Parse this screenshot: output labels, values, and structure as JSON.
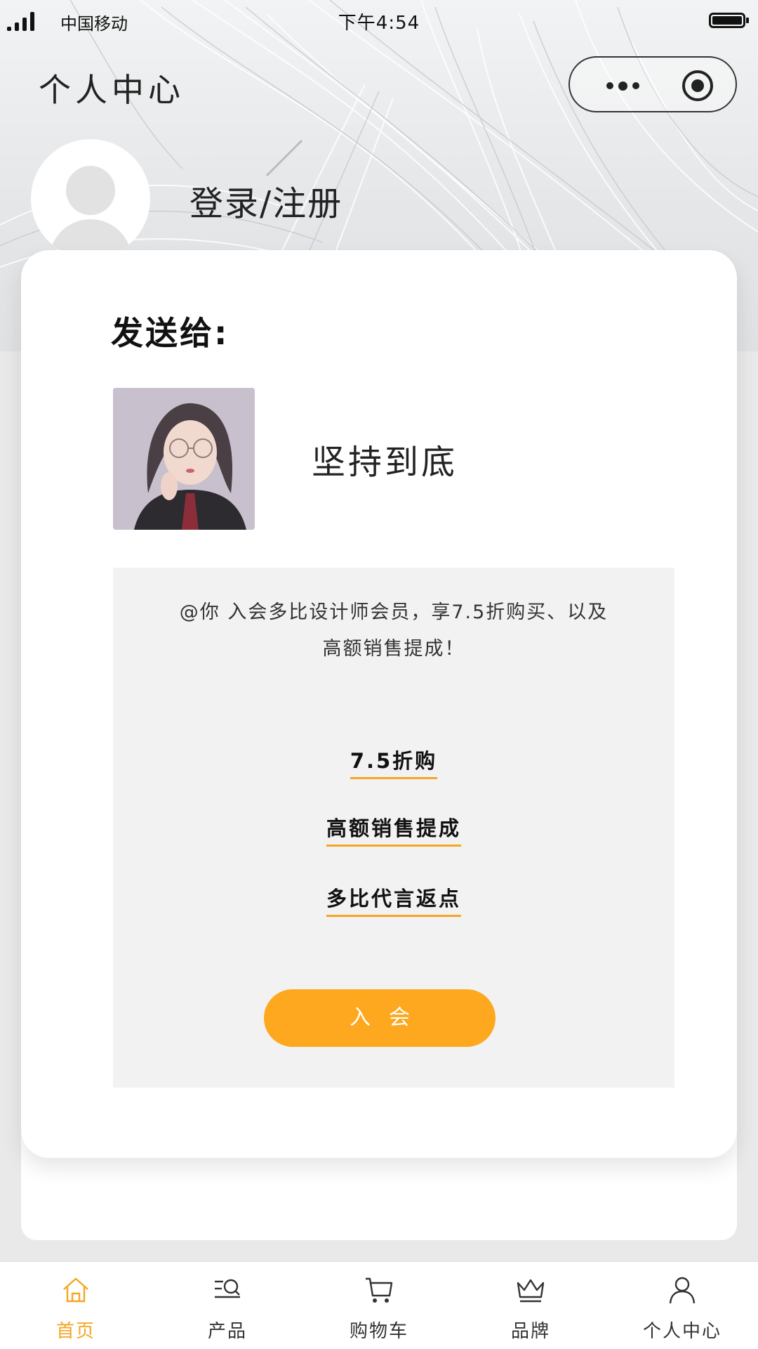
{
  "status_bar": {
    "carrier": "中国移动",
    "time": "下午4:54"
  },
  "nav": {
    "title": "个人中心",
    "capsule_more_icon": "more-dots-icon",
    "capsule_close_icon": "target-icon"
  },
  "profile": {
    "login_label": "登录/注册",
    "avatar_icon": "default-avatar-icon"
  },
  "card": {
    "send_to_label": "发送给:",
    "friend_name": "坚持到底",
    "invite_line1": "@你 入会多比设计师会员，享7.5折购买、以及",
    "invite_line2": "高额销售提成！",
    "benefits": [
      "7.5折购",
      "高额销售提成",
      "多比代言返点"
    ],
    "join_button": "入会"
  },
  "tabbar": {
    "items": [
      {
        "label": "首页",
        "icon": "home-icon",
        "active": true
      },
      {
        "label": "产品",
        "icon": "product-search-icon",
        "active": false
      },
      {
        "label": "购物车",
        "icon": "cart-icon",
        "active": false
      },
      {
        "label": "品牌",
        "icon": "crown-icon",
        "active": false
      },
      {
        "label": "个人中心",
        "icon": "user-icon",
        "active": false
      }
    ]
  },
  "colors": {
    "accent": "#f5a623",
    "button": "#fda81e",
    "panel_bg": "#f2f2f2"
  }
}
